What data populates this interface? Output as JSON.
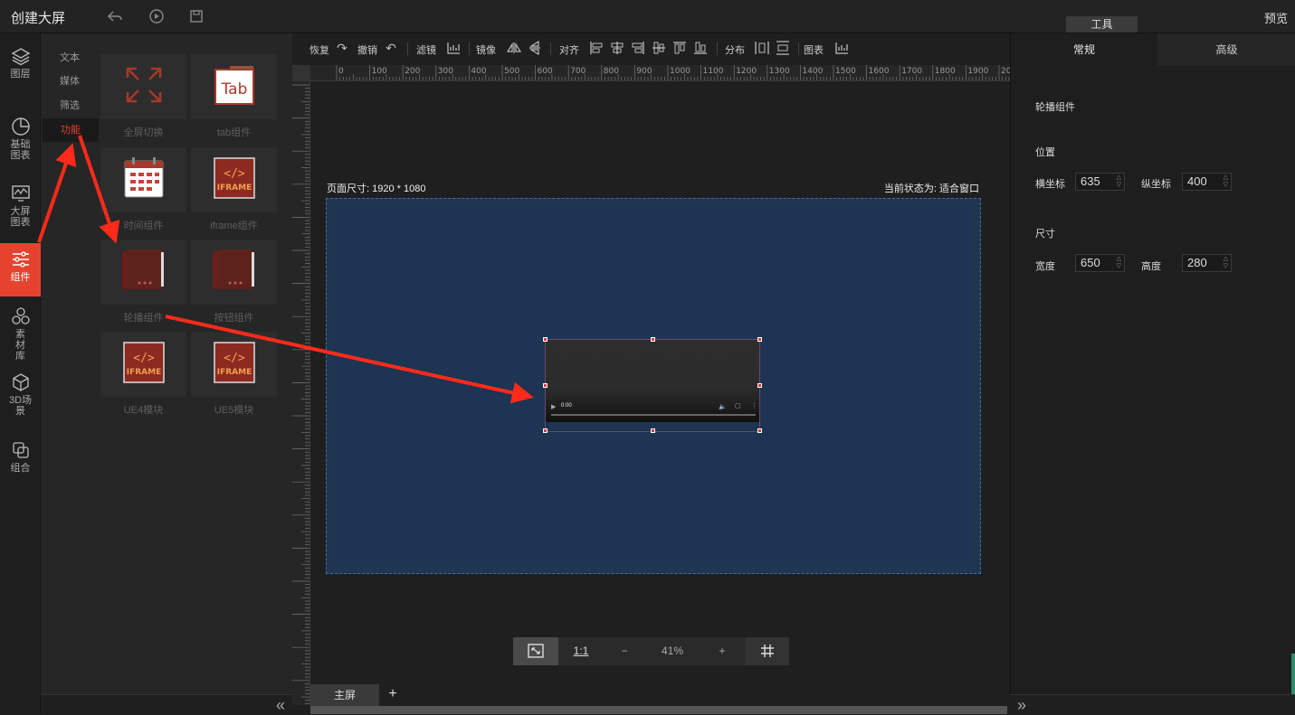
{
  "header": {
    "title": "创建大屏",
    "tool_badge": "工具",
    "preview": "预览",
    "icons": [
      "back-icon",
      "play-icon",
      "save-icon"
    ]
  },
  "leftnav": {
    "items": [
      {
        "label": "图层",
        "icon": "layers-icon"
      },
      {
        "label": "基础图表",
        "icon": "pie-chart-icon"
      },
      {
        "label": "大屏图表",
        "icon": "monitor-chart-icon"
      },
      {
        "label": "组件",
        "icon": "sliders-icon",
        "active": true
      },
      {
        "label": "素材库",
        "icon": "hexagons-icon"
      },
      {
        "label": "3D场景",
        "icon": "cube-icon"
      },
      {
        "label": "组合",
        "icon": "group-icon"
      }
    ],
    "accent": "#e5432f"
  },
  "subnav": {
    "items": [
      "文本",
      "媒体",
      "筛选",
      "功能"
    ],
    "active": "功能"
  },
  "components": [
    {
      "label": "全屏切换",
      "icon": "fullscreen-icon"
    },
    {
      "label": "tab组件",
      "icon": "tab-icon"
    },
    {
      "label": "时间组件",
      "icon": "calendar-icon"
    },
    {
      "label": "iframe组件",
      "icon": "iframe-icon"
    },
    {
      "label": "轮播组件",
      "icon": "carousel-icon"
    },
    {
      "label": "按钮组件",
      "icon": "button-carousel-icon"
    },
    {
      "label": "UE4模块",
      "icon": "iframe-icon"
    },
    {
      "label": "UE5模块",
      "icon": "iframe-icon"
    }
  ],
  "toolbar": {
    "redo": "恢复",
    "undo": "撤销",
    "filter": "滤镜",
    "mirror": "镜像",
    "align": "对齐",
    "distribute": "分布",
    "chart": "图表"
  },
  "ruler_h": [
    "0",
    "100",
    "200",
    "300",
    "400",
    "500",
    "600",
    "700",
    "800",
    "900",
    "1000",
    "1100",
    "1200",
    "1300",
    "1400",
    "1500",
    "1600",
    "1700",
    "1800",
    "1900",
    "20"
  ],
  "canvas": {
    "page_size": "页面尺寸: 1920 * 1080",
    "current_state": "当前状态为: 适合窗口",
    "video_time": "0:00"
  },
  "zoom": {
    "ratio_label": "1:1",
    "minus": "−",
    "percent": "41%",
    "plus": "+"
  },
  "tabs": {
    "main": "主屏",
    "add": "+"
  },
  "rightpanel": {
    "tab_normal": "常规",
    "tab_advanced": "高级",
    "component_name": "轮播组件",
    "position_title": "位置",
    "x_label": "横坐标",
    "x_value": "635",
    "y_label": "纵坐标",
    "y_value": "400",
    "size_title": "尺寸",
    "width_label": "宽度",
    "width_value": "650",
    "height_label": "高度",
    "height_value": "280"
  },
  "colors": {
    "annotation_arrow": "#ff2a1a",
    "canvas_bg": "#1d3452"
  }
}
